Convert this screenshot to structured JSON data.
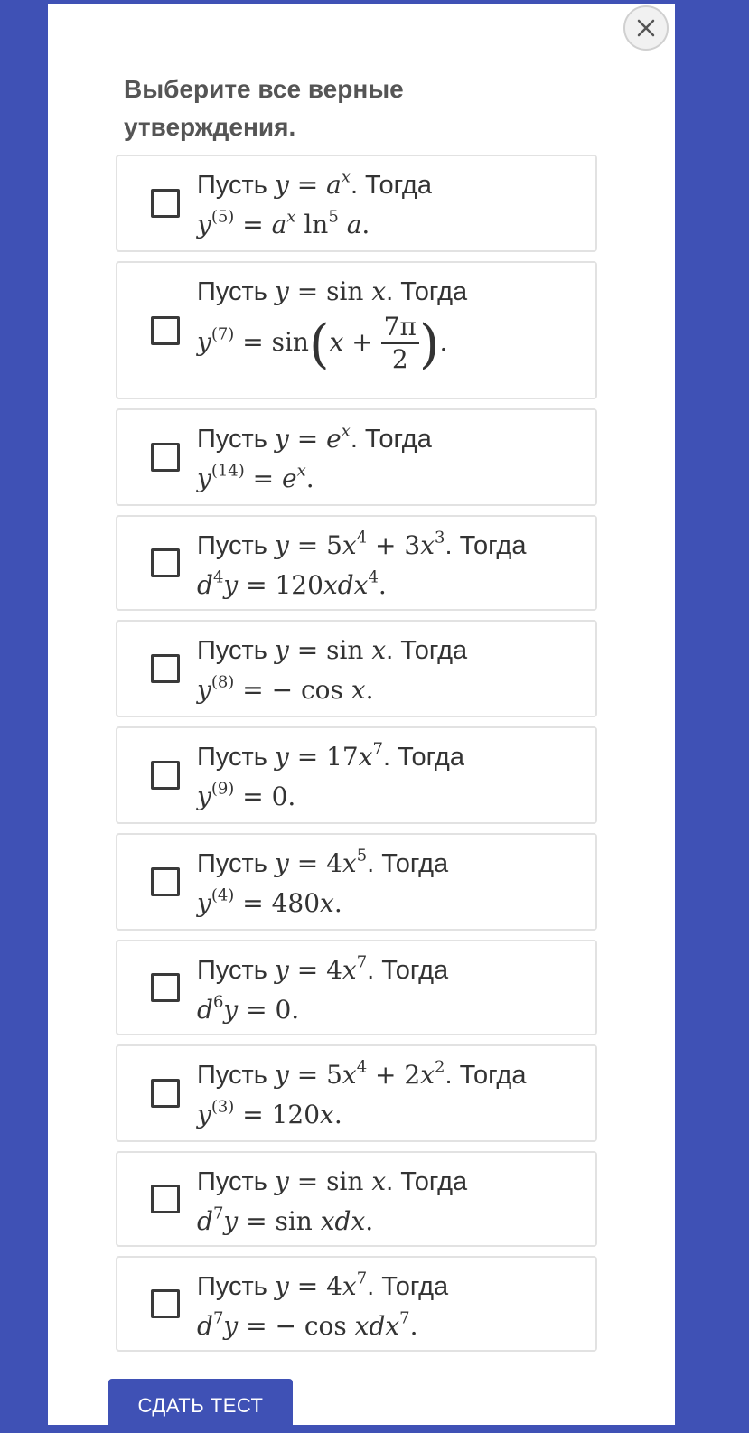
{
  "title": "Выберите все верные утверждения.",
  "close_icon": "close-icon",
  "submit_label": "СДАТЬ ТЕСТ",
  "colors": {
    "background": "#3f51b5",
    "panel": "#ffffff",
    "button": "#3f51b5"
  },
  "options": [
    {
      "prefix": "Пусть",
      "suffix": ". Тогда",
      "math1": "y = a^x",
      "math2": "y^{(5)} = a^x ln^5 a."
    },
    {
      "prefix": "Пусть",
      "suffix": ". Тогда",
      "math1": "y = sin x",
      "math2": "y^{(7)} = sin(x + 7π/2)."
    },
    {
      "prefix": "Пусть",
      "suffix": ". Тогда",
      "math1": "y = e^x",
      "math2": "y^{(14)} = e^x."
    },
    {
      "prefix": "Пусть",
      "suffix": ". Тогда",
      "math1": "y = 5x^4 + 3x^3",
      "math2": "d^4 y = 120x dx^4."
    },
    {
      "prefix": "Пусть",
      "suffix": ". Тогда",
      "math1": "y = sin x",
      "math2": "y^{(8)} = −cos x."
    },
    {
      "prefix": "Пусть",
      "suffix": ". Тогда",
      "math1": "y = 17x^7",
      "math2": "y^{(9)} = 0."
    },
    {
      "prefix": "Пусть",
      "suffix": ". Тогда",
      "math1": "y = 4x^5",
      "math2": "y^{(4)} = 480x."
    },
    {
      "prefix": "Пусть",
      "suffix": ". Тогда",
      "math1": "y = 4x^7",
      "math2": "d^6 y = 0."
    },
    {
      "prefix": "Пусть",
      "suffix": ". Тогда",
      "math1": "y = 5x^4 + 2x^2",
      "math2": "y^{(3)} = 120x."
    },
    {
      "prefix": "Пусть",
      "suffix": ". Тогда",
      "math1": "y = sin x",
      "math2": "d^7 y = sin x dx."
    },
    {
      "prefix": "Пусть",
      "suffix": ". Тогда",
      "math1": "y = 4x^7",
      "math2": "d^7 y = −cos x dx^7."
    }
  ]
}
